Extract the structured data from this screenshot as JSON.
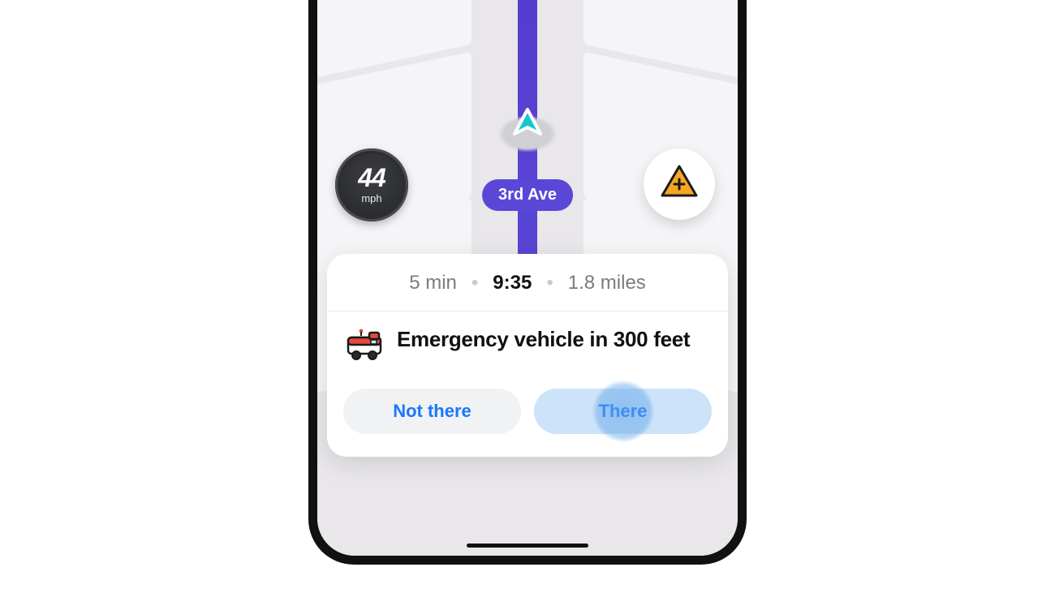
{
  "speedometer": {
    "value": "44",
    "unit": "mph"
  },
  "street": {
    "name": "3rd Ave"
  },
  "trip": {
    "remaining_time": "5 min",
    "eta": "9:35",
    "distance": "1.8 miles"
  },
  "alert": {
    "message": "Emergency vehicle in 300 feet",
    "not_there_label": "Not there",
    "there_label": "There"
  },
  "icons": {
    "vehicle_arrow": "navigation-arrow-icon",
    "report": "hazard-report-icon",
    "emergency": "emergency-vehicle-icon"
  },
  "colors": {
    "route": "#5a47d7",
    "action_blue": "#1a77ff",
    "there_bg": "#cde3f9",
    "hazard_orange": "#f5a623"
  }
}
